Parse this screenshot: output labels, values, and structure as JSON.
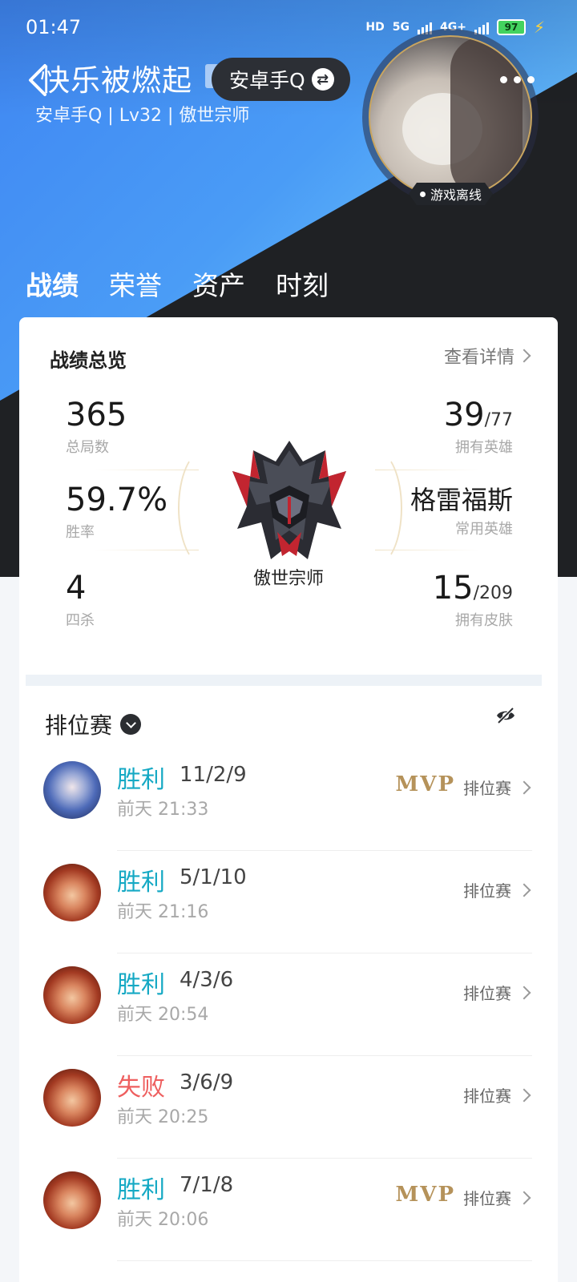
{
  "status_bar": {
    "time": "01:47",
    "network1": "HD",
    "network2": "5G",
    "network3": "4G+",
    "battery": "97"
  },
  "header": {
    "player_name": "快乐被燃起",
    "account_label": "安卓手Q",
    "sub_info": "安卓手Q | Lv32 | 傲世宗师",
    "online_status": "游戏离线"
  },
  "tabs": [
    {
      "label": "战绩",
      "active": true
    },
    {
      "label": "荣誉",
      "active": false
    },
    {
      "label": "资产",
      "active": false
    },
    {
      "label": "时刻",
      "active": false
    }
  ],
  "overview": {
    "title": "战绩总览",
    "detail_link": "查看详情",
    "total_games": {
      "value": "365",
      "label": "总局数"
    },
    "win_rate": {
      "value": "59.7%",
      "label": "胜率"
    },
    "quadra_kills": {
      "value": "4",
      "label": "四杀"
    },
    "heroes_owned": {
      "value": "39",
      "total": "/77",
      "label": "拥有英雄"
    },
    "favorite_hero": {
      "value": "格雷福斯",
      "label": "常用英雄"
    },
    "skins_owned": {
      "value": "15",
      "total": "/209",
      "label": "拥有皮肤"
    },
    "rank": "傲世宗师"
  },
  "ranked": {
    "title": "排位赛",
    "matches": [
      {
        "result": "胜利",
        "outcome": "win",
        "kda": "11/2/9",
        "time": "前天 21:33",
        "mvp": "MVP",
        "mode": "排位赛",
        "hero_icon": "hero-avatar-blue"
      },
      {
        "result": "胜利",
        "outcome": "win",
        "kda": "5/1/10",
        "time": "前天 21:16",
        "mvp": "",
        "mode": "排位赛",
        "hero_icon": "hero-avatar-red"
      },
      {
        "result": "胜利",
        "outcome": "win",
        "kda": "4/3/6",
        "time": "前天 20:54",
        "mvp": "",
        "mode": "排位赛",
        "hero_icon": "hero-avatar-red"
      },
      {
        "result": "失败",
        "outcome": "lose",
        "kda": "3/6/9",
        "time": "前天 20:25",
        "mvp": "",
        "mode": "排位赛",
        "hero_icon": "hero-avatar-red"
      },
      {
        "result": "胜利",
        "outcome": "win",
        "kda": "7/1/8",
        "time": "前天 20:06",
        "mvp": "MVP",
        "mode": "排位赛",
        "hero_icon": "hero-avatar-red"
      }
    ]
  },
  "colors": {
    "win": "#16a9c4",
    "lose": "#ee5f5f",
    "mvp_gold": "#b5925a",
    "hero_blue": "#3f86f2",
    "hero_dark": "#1f2124"
  }
}
